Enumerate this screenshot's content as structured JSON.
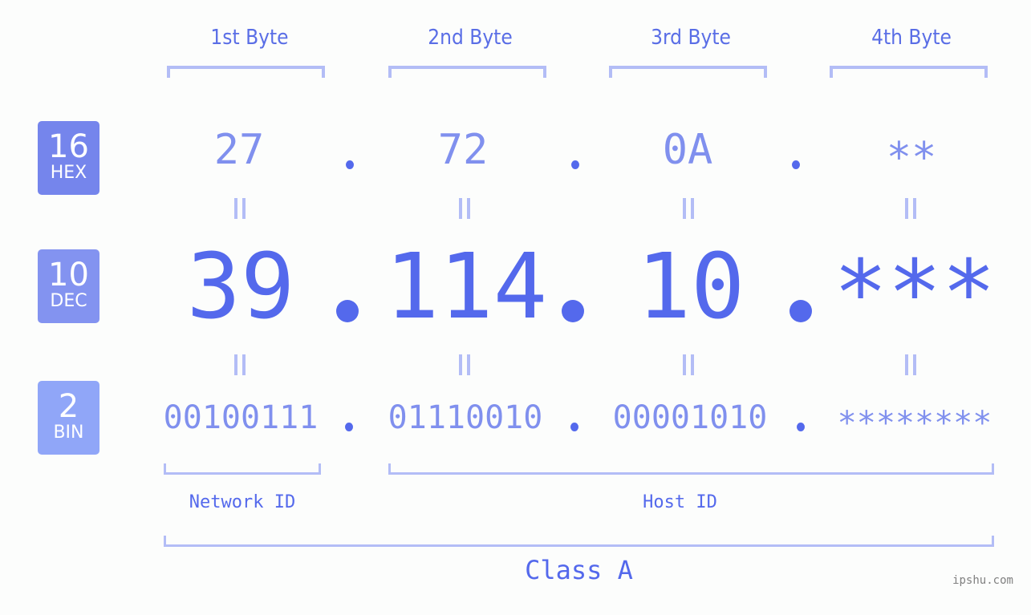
{
  "bytes": {
    "labels": [
      "1st Byte",
      "2nd Byte",
      "3rd Byte",
      "4th Byte"
    ]
  },
  "badges": {
    "hex": {
      "number": "16",
      "label": "HEX",
      "color": "#7585ec"
    },
    "dec": {
      "number": "10",
      "label": "DEC",
      "color": "#8393f0"
    },
    "bin": {
      "number": "2",
      "label": "BIN",
      "color": "#90a6f8"
    }
  },
  "ip": {
    "hex": [
      "27",
      "72",
      "0A",
      "**"
    ],
    "dec": [
      "39",
      "114",
      "10",
      "***"
    ],
    "bin": [
      "00100111",
      "01110010",
      "00001010",
      "********"
    ],
    "separator": "."
  },
  "segments": {
    "network_id": "Network ID",
    "host_id": "Host ID",
    "class": "Class A"
  },
  "watermark": "ipshu.com",
  "colors": {
    "primary": "#5469ec",
    "secondary": "#8090ee",
    "bracket": "#b3bdf6"
  }
}
